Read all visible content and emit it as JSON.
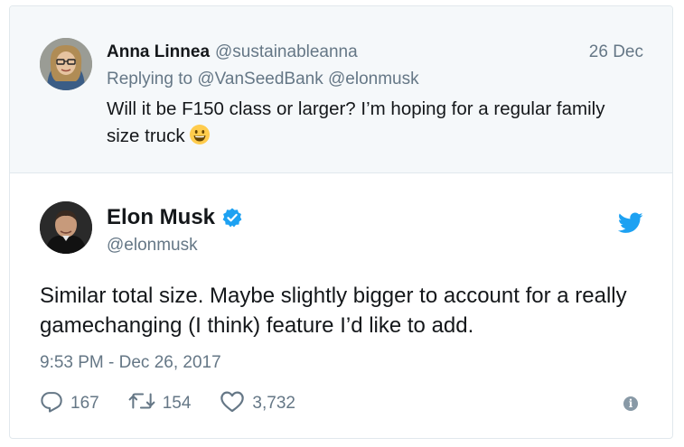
{
  "reply_tweet": {
    "author_name": "Anna Linnea",
    "author_handle": "@sustainableanna",
    "date": "26 Dec",
    "replying_prefix": "Replying to",
    "replying_to": "@VanSeedBank @elonmusk",
    "text": "Will it be F150 class or larger? I’m hoping for a regular family size truck",
    "emoji": "grinning-face-emoji"
  },
  "main_tweet": {
    "author_name": "Elon Musk",
    "author_handle": "@elonmusk",
    "verified": true,
    "text": "Similar total size. Maybe slightly bigger to account for a really gamechanging (I think) feature I’d like to add.",
    "timestamp": "9:53 PM - Dec 26, 2017",
    "reply_count": "167",
    "retweet_count": "154",
    "like_count": "3,732"
  },
  "icons": {
    "reply": "reply-icon",
    "retweet": "retweet-icon",
    "like": "heart-icon",
    "info": "info-icon",
    "brand": "twitter-bird-icon",
    "verified": "verified-badge-icon"
  },
  "colors": {
    "twitter_blue": "#1da1f2",
    "secondary_text": "#657786",
    "reply_background": "#f5f8fa"
  }
}
